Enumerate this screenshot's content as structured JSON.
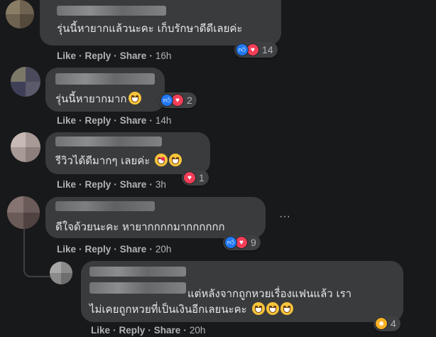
{
  "comments": [
    {
      "text": "รุ่นนี้หายากแล้วนะคะ เก็บรักษาดีดีเลยค่ะ",
      "actions": {
        "like": "Like",
        "reply": "Reply",
        "share": "Share",
        "time": "16h"
      },
      "reactions": {
        "types": [
          "like",
          "love"
        ],
        "count": "14"
      }
    },
    {
      "text": "รุ่นนี้หายากมาก",
      "actions": {
        "like": "Like",
        "reply": "Reply",
        "share": "Share",
        "time": "14h"
      },
      "reactions": {
        "types": [
          "like",
          "love"
        ],
        "count": "2"
      }
    },
    {
      "text": "รีวิวได้ดีมากๆ เลยค่ะ",
      "actions": {
        "like": "Like",
        "reply": "Reply",
        "share": "Share",
        "time": "3h"
      },
      "reactions": {
        "types": [
          "love"
        ],
        "count": "1"
      }
    },
    {
      "text": "ดีใจด้วยนะคะ หายากกกกมากกกกกก",
      "actions": {
        "like": "Like",
        "reply": "Reply",
        "share": "Share",
        "time": "20h"
      },
      "reactions": {
        "types": [
          "like",
          "love"
        ],
        "count": "9"
      },
      "more_icon": "···"
    },
    {
      "line1": "แต่หลังจากถูกหวยเรื่องแฟนแล้ว เรา",
      "line2": "ไม่เคยถูกหวยที่เป็นเงินอีกเลยนะคะ",
      "actions": {
        "like": "Like",
        "reply": "Reply",
        "share": "Share",
        "time": "20h"
      },
      "reactions": {
        "types": [
          "haha"
        ],
        "count": "4"
      }
    }
  ],
  "colors": {
    "background": "#18191a",
    "bubble": "#3a3b3c",
    "like": "#2078f4",
    "love": "#f33e58",
    "haha": "#f7b125"
  }
}
